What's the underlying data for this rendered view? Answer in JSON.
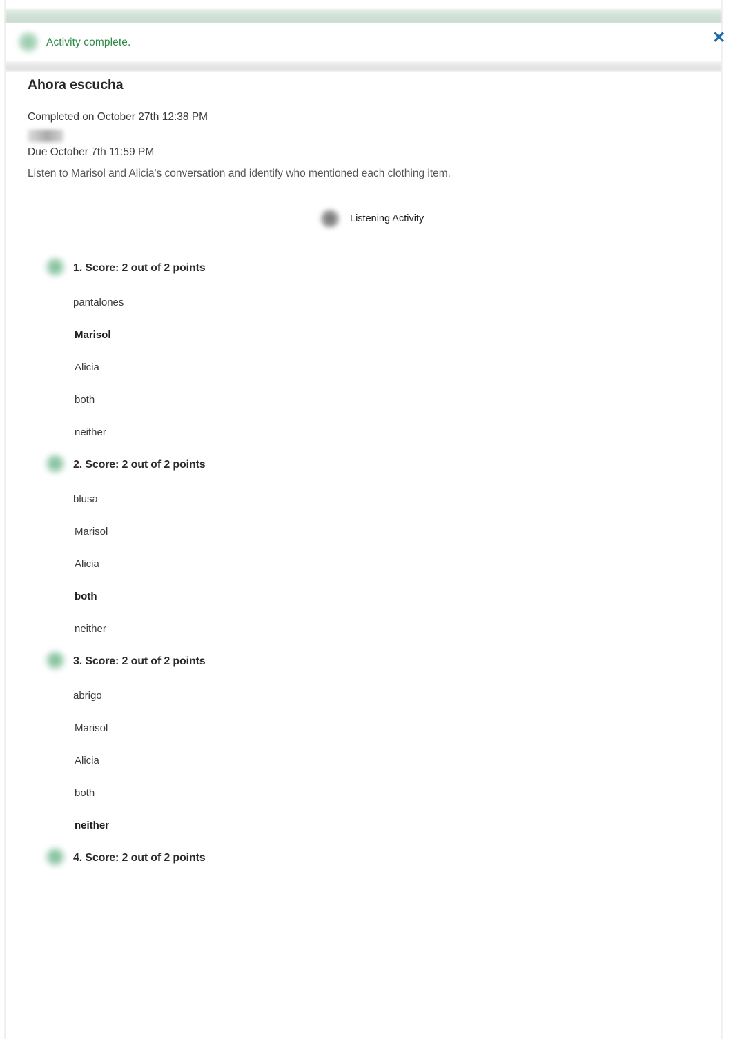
{
  "banner": {
    "message": "Activity complete.",
    "close_label": "✕",
    "status_icon": "green-check-circle-icon",
    "text_color": "#2e8b48",
    "strip_color": "#cfdfd5",
    "close_color": "#1c6ca8"
  },
  "activity": {
    "title": "Ahora escucha",
    "completed": "Completed on October 27th 12:38 PM",
    "due": "Due October 7th 11:59 PM",
    "description": "Listen to Marisol and Alicia's conversation and identify who mentioned each clothing item.",
    "media_label": "Listening Activity",
    "media_icon": "audio-player-icon"
  },
  "questions": [
    {
      "heading": "1. Score: 2 out of 2 points",
      "prompt": "pantalones",
      "options": [
        {
          "label": "Marisol",
          "selected": true
        },
        {
          "label": "Alicia",
          "selected": false
        },
        {
          "label": "both",
          "selected": false
        },
        {
          "label": "neither",
          "selected": false
        }
      ]
    },
    {
      "heading": "2. Score: 2 out of 2 points",
      "prompt": "blusa",
      "options": [
        {
          "label": "Marisol",
          "selected": false
        },
        {
          "label": "Alicia",
          "selected": false
        },
        {
          "label": "both",
          "selected": true
        },
        {
          "label": "neither",
          "selected": false
        }
      ]
    },
    {
      "heading": "3. Score: 2 out of 2 points",
      "prompt": "abrigo",
      "options": [
        {
          "label": "Marisol",
          "selected": false
        },
        {
          "label": "Alicia",
          "selected": false
        },
        {
          "label": "both",
          "selected": false
        },
        {
          "label": "neither",
          "selected": true
        }
      ]
    },
    {
      "heading": "4. Score: 2 out of 2 points",
      "prompt": "",
      "options": []
    }
  ]
}
